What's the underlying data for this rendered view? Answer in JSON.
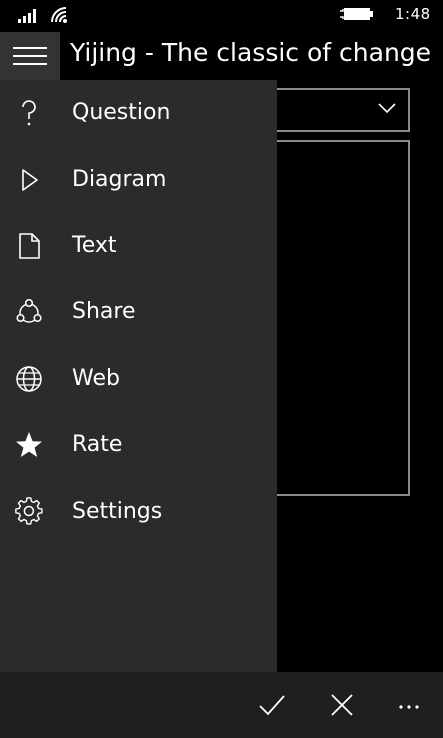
{
  "status": {
    "time": "1:48"
  },
  "header": {
    "title": "Yijing - The classic of change"
  },
  "nav": {
    "items": [
      {
        "label": "Question",
        "icon": "question-icon"
      },
      {
        "label": "Diagram",
        "icon": "play-icon"
      },
      {
        "label": "Text",
        "icon": "document-icon"
      },
      {
        "label": "Share",
        "icon": "share-icon"
      },
      {
        "label": "Web",
        "icon": "globe-icon"
      },
      {
        "label": "Rate",
        "icon": "star-icon"
      },
      {
        "label": "Settings",
        "icon": "gear-icon"
      }
    ]
  },
  "appbar": {
    "buttons": [
      "checkmark-icon",
      "close-icon",
      "more-icon"
    ]
  },
  "colors": {
    "pane": "#2b2b2b",
    "background": "#000000",
    "appbar": "#1f1f1f",
    "border": "#8a8a8a"
  }
}
